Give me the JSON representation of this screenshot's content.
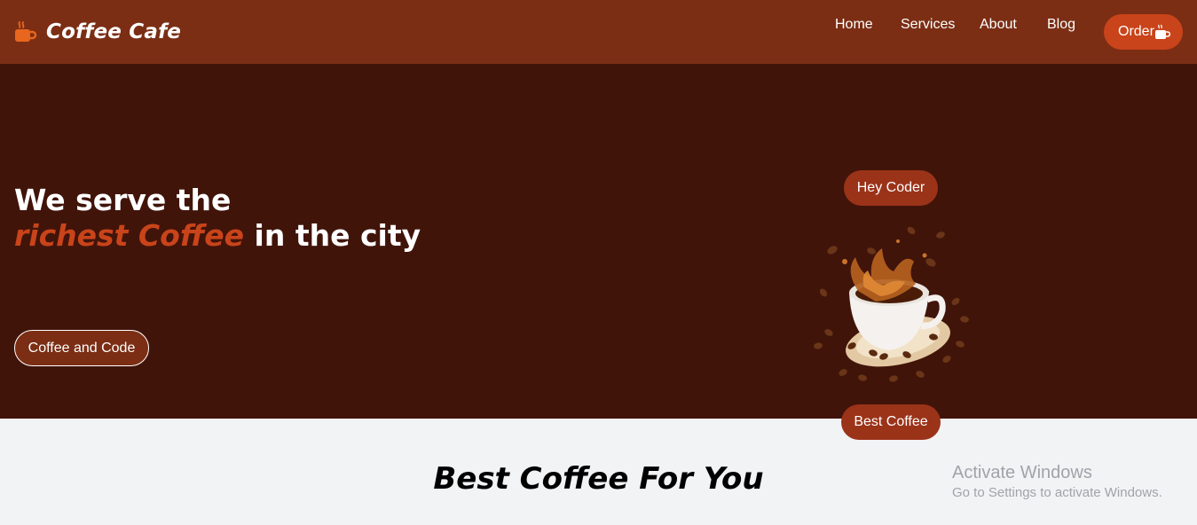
{
  "navbar": {
    "brand_name": "Coffee Cafe",
    "brand_icon": "coffee-cup-icon",
    "links": [
      "Home",
      "Services",
      "About",
      "Blog"
    ],
    "order_label": "Order",
    "order_icon": "coffee-cup-icon"
  },
  "hero": {
    "headline_line1": "We serve the",
    "headline_accent": "richest Coffee",
    "headline_rest": " in the city",
    "button_label": "Coffee and Code",
    "pill_top": "Hey Coder",
    "pill_bottom": "Best Coffee"
  },
  "section": {
    "title": "Best Coffee For You"
  },
  "watermark": {
    "title": "Activate Windows",
    "subtitle": "Go to Settings to activate Windows."
  },
  "colors": {
    "navbar_bg": "#7b2e14",
    "hero_bg": "#41140a",
    "accent": "#c9441a",
    "pill_bg": "#9b3319",
    "page_bg": "#f2f3f5"
  }
}
